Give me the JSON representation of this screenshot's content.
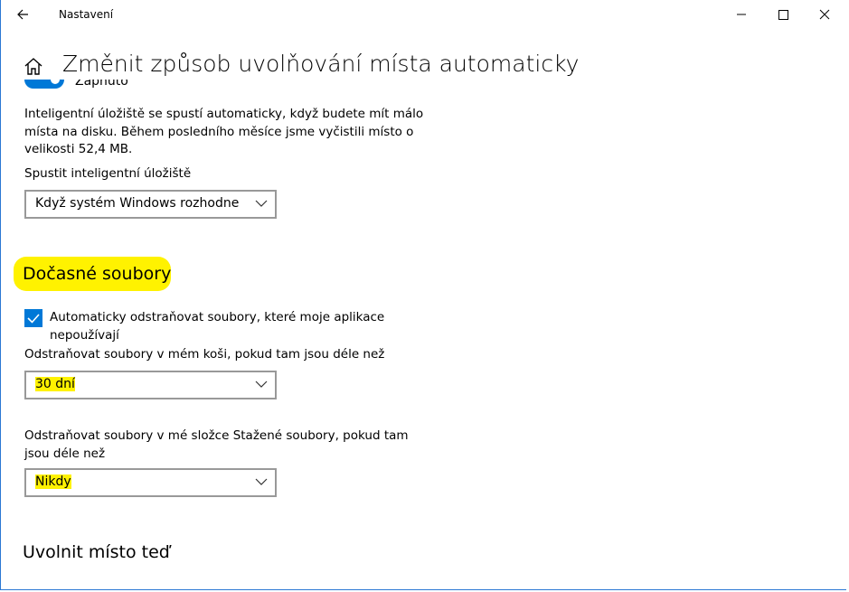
{
  "window": {
    "title": "Nastavení"
  },
  "header": {
    "title": "Změnit způsob uvolňování místa automaticky"
  },
  "storage_sense": {
    "toggle_label": "Zapnuto",
    "description": "Inteligentní úložiště se spustí automaticky, když budete mít málo místa na disku. Během posledního měsíce jsme vyčistili místo o velikosti 52,4 MB.",
    "run_label": "Spustit inteligentní úložiště",
    "run_value": "Když systém Windows rozhodne"
  },
  "temp_files": {
    "title": "Dočasné soubory",
    "checkbox_label": "Automaticky odstraňovat soubory, které moje aplikace nepoužívají",
    "checkbox_checked": true,
    "recycle_label": "Odstraňovat soubory v mém koši, pokud tam jsou déle než",
    "recycle_value": "30 dní",
    "downloads_label": "Odstraňovat soubory v mé složce Stažené soubory, pokud tam jsou déle než",
    "downloads_value": "Nikdy"
  },
  "free_now": {
    "title": "Uvolnit místo teď"
  },
  "colors": {
    "accent": "#0078d7",
    "highlight": "#fff200",
    "window_border": "#2b78d4"
  },
  "icons": {
    "back": "back-arrow-icon",
    "home": "home-icon",
    "minimize": "minimize-icon",
    "maximize": "maximize-icon",
    "close": "close-icon",
    "chevron": "chevron-down-icon",
    "check": "checkmark-icon"
  }
}
